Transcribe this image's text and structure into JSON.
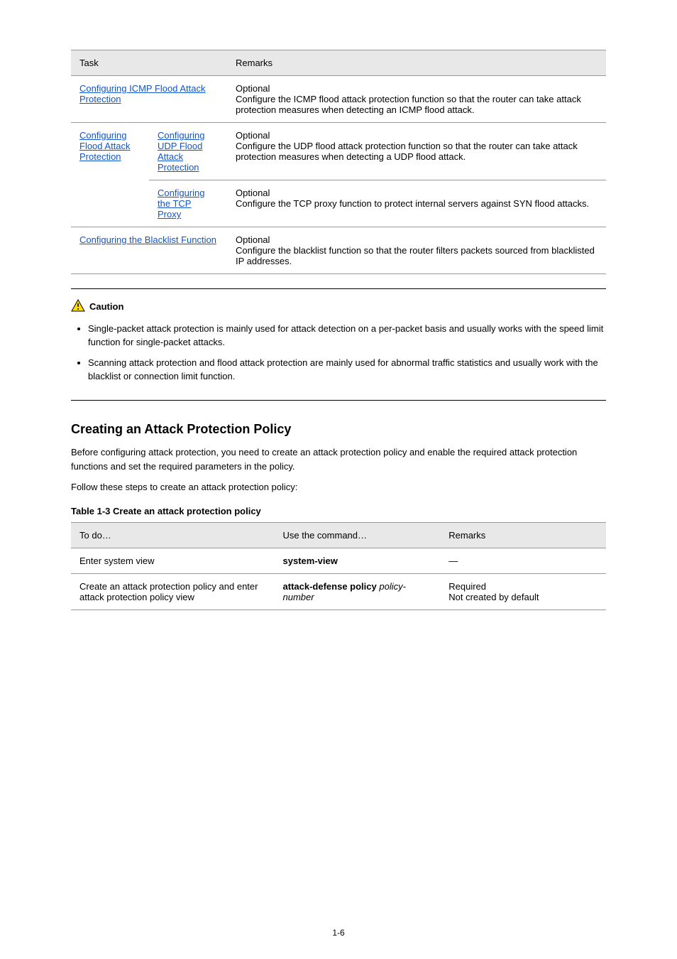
{
  "table1": {
    "headers": [
      "Task",
      "Remarks"
    ],
    "rows": [
      {
        "task_link": "Configuring ICMP Flood Attack Protection",
        "remarks": "Optional\nConfigure the ICMP flood attack protection function so that the router can take attack protection measures when detecting an ICMP flood attack."
      }
    ],
    "nested_label_link": "Configuring Flood Attack Protection",
    "nested": [
      {
        "task_link": "Configuring UDP Flood Attack Protection",
        "remarks": "Optional\nConfigure the UDP flood attack protection function so that the router can take attack protection measures when detecting a UDP flood attack."
      },
      {
        "task_link_a": "Configuring the TCP",
        "task_link_b": "Proxy",
        "remarks": "Optional\nConfigure the TCP proxy function to protect internal servers against SYN flood attacks."
      }
    ],
    "final_row": {
      "task_link": "Configuring the Blacklist Function",
      "remarks": "Optional\nConfigure the blacklist function so that the router filters packets sourced from blacklisted IP addresses."
    }
  },
  "caution": {
    "label": "Caution",
    "items": [
      "Single-packet attack protection is mainly used for attack detection on a per-packet basis and usually works with the speed limit function for single-packet attacks.",
      "Scanning attack protection and flood attack protection are mainly used for abnormal traffic statistics and usually work with the blacklist or connection limit function."
    ]
  },
  "section_title": "Creating an Attack Protection Policy",
  "section_body": "Before configuring attack protection, you need to create an attack protection policy and enable the required attack protection functions and set the required parameters in the policy.",
  "follow_steps": "Follow these steps to create an attack protection policy:",
  "table2_title": "Table 1-3 Create an attack protection policy",
  "table2": {
    "headers": [
      "To do…",
      "Use the command…",
      "Remarks"
    ],
    "rows": [
      {
        "c1": "Enter system view",
        "c2": "system-view",
        "c3": "—"
      },
      {
        "c1": "Create an attack protection policy and enter attack protection policy view",
        "c2": "attack-defense policy policy-number",
        "c3": "Required\nNot created by default"
      }
    ]
  },
  "page_number": "1-6"
}
